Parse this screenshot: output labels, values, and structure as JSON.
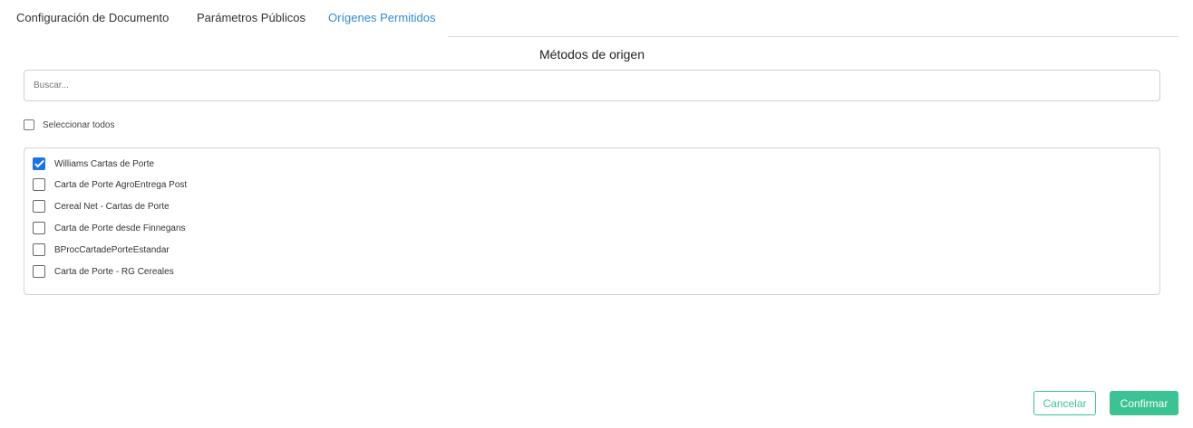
{
  "tabs": [
    {
      "label": "Configuración de Documento",
      "active": false
    },
    {
      "label": "Parámetros Públicos",
      "active": false
    },
    {
      "label": "Orígenes Permitidos",
      "active": true
    }
  ],
  "section": {
    "title": "Métodos de origen"
  },
  "search": {
    "placeholder": "Buscar...",
    "value": ""
  },
  "select_all": {
    "label": "Seleccionar todos",
    "checked": false
  },
  "methods": [
    {
      "label": "Williams Cartas de Porte",
      "checked": true
    },
    {
      "label": "Carta de Porte AgroEntrega Post",
      "checked": false
    },
    {
      "label": "Cereal Net - Cartas de Porte",
      "checked": false
    },
    {
      "label": "Carta de Porte desde Finnegans",
      "checked": false
    },
    {
      "label": "BProcCartadePorteEstandar",
      "checked": false
    },
    {
      "label": "Carta de Porte - RG Cereales",
      "checked": false
    }
  ],
  "actions": {
    "cancel_label": "Cancelar",
    "confirm_label": "Confirmar"
  },
  "colors": {
    "active_tab": "#2f8bd6",
    "accent_green": "#3cc394",
    "checkbox_checked": "#1a73e8"
  }
}
